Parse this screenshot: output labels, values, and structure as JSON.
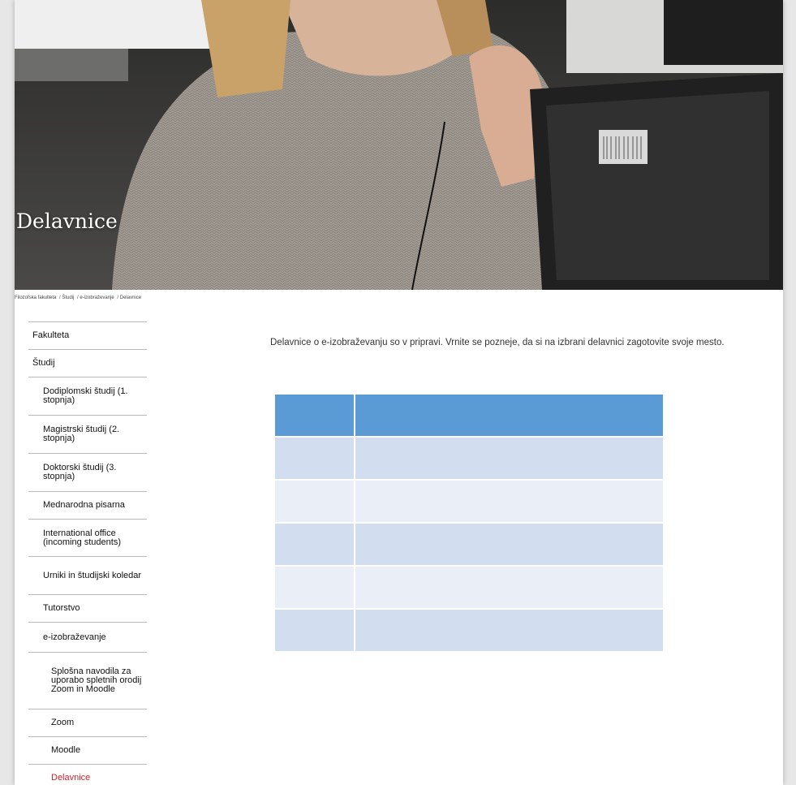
{
  "hero": {
    "title": "Delavnice"
  },
  "breadcrumb": [
    "Filozofska fakulteta",
    "/ Študij",
    "/ e-izobraževanje",
    "/ Delavnice"
  ],
  "sidebar": {
    "items": [
      {
        "label": "Fakulteta",
        "level": 1
      },
      {
        "label": "Študij",
        "level": 1
      },
      {
        "label": "Dodiplomski študij (1. stopnja)",
        "level": 2
      },
      {
        "label": "Magistrski študij (2. stopnja)",
        "level": 2
      },
      {
        "label": "Doktorski študij (3. stopnja)",
        "level": 2
      },
      {
        "label": "Mednarodna pisarna",
        "level": 2
      },
      {
        "label": "International office (incoming students)",
        "level": 2
      },
      {
        "label": "Urniki in študijski koledar",
        "level": 2
      },
      {
        "label": "Tutorstvo",
        "level": 2
      },
      {
        "label": "e-izobraževanje",
        "level": 2
      },
      {
        "label": "Splošna navodila za uporabo spletnih orodij Zoom in Moodle",
        "level": 3
      },
      {
        "label": "Zoom",
        "level": 3
      },
      {
        "label": "Moodle",
        "level": 3
      },
      {
        "label": "Delavnice",
        "level": 3,
        "active": true
      }
    ]
  },
  "content": {
    "intro": "Delavnice o e-izobraževanju so v pripravi. Vrnite se pozneje, da si na izbrani delavnici zagotovite svoje mesto."
  },
  "table": {
    "header": [
      "",
      ""
    ],
    "rows": [
      [
        "",
        ""
      ],
      [
        "",
        ""
      ],
      [
        "",
        ""
      ],
      [
        "",
        ""
      ],
      [
        "",
        ""
      ]
    ]
  },
  "colors": {
    "accent": "#d0202a",
    "table_header": "#5b9bd5",
    "row_odd": "#d2deef",
    "row_even": "#eaeff7"
  }
}
